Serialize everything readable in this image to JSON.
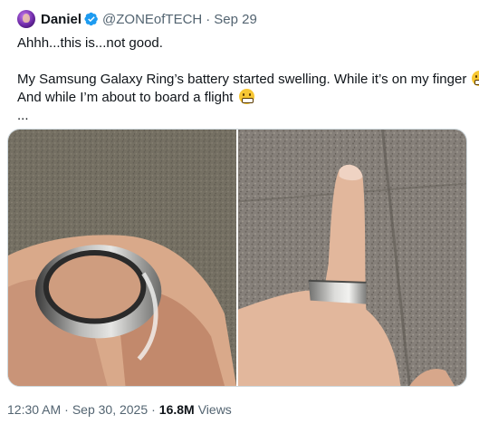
{
  "tweet": {
    "author": {
      "name": "Daniel",
      "handle": "@ZONEofTECH",
      "separator": "·",
      "date": "Sep 29",
      "verified_color": "#1d9bf0"
    },
    "text": {
      "line1": "Ahhh...this is...not good.",
      "line2": "My Samsung Galaxy Ring’s battery started swelling. While it’s on my finger",
      "line2_end": ".",
      "line3": "And while I’m about to board a flight",
      "line4": "..."
    },
    "emoji": "grimacing-face",
    "media": [
      {
        "alt_icon": "photo-hand-ring-closeup"
      },
      {
        "alt_icon": "photo-finger-ring"
      }
    ],
    "footer": {
      "time": "12:30 AM",
      "separator": "·",
      "date": "Sep 30, 2025",
      "separator2": "·",
      "views_count": "16.8M",
      "views_label": "Views"
    }
  },
  "colors": {
    "text_primary": "#0f1419",
    "text_secondary": "#536471",
    "border": "#cfd9de"
  }
}
